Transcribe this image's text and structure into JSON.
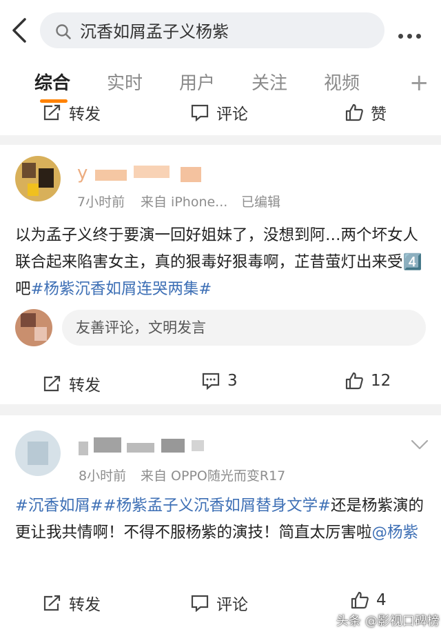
{
  "search": {
    "query": "沉香如屑孟子义杨紫"
  },
  "tabs": [
    {
      "label": "综合",
      "active": true
    },
    {
      "label": "实时",
      "active": false
    },
    {
      "label": "用户",
      "active": false
    },
    {
      "label": "关注",
      "active": false
    },
    {
      "label": "视频",
      "active": false
    }
  ],
  "add_tab": "+",
  "colors": {
    "accent": "#ff8200",
    "topic": "#3d6fb5"
  },
  "prev_post": {
    "actions": {
      "repost": "转发",
      "comment": "评论",
      "like": "赞"
    }
  },
  "post1": {
    "username": "y",
    "time": "7小时前",
    "source": "来自 iPhone...",
    "edited": "已编辑",
    "text_1": "以为孟子义终于要演一回好姐妹了，没想到阿…两个坏女人联合起来陷害女主，真的狠毒好狠毒啊，芷昔萤灯出来受",
    "emoji": "4️⃣",
    "text_2": "吧",
    "topic": "#杨紫沉香如屑连哭两集#",
    "comment_placeholder": "友善评论，文明发言",
    "actions": {
      "repost": "转发",
      "comment_count": "3",
      "like_count": "12"
    }
  },
  "post2": {
    "time": "8小时前",
    "source": "来自 OPPO随光而变R17",
    "topic_1": "#沉香如屑#",
    "topic_2": "#杨紫孟子义沉香如屑替身文学#",
    "text": "还是杨紫演的更让我共情啊！不得不服杨紫的演技！简直太厉害啦",
    "mention": "@杨紫",
    "actions": {
      "repost": "转发",
      "comment": "评论",
      "like_count": "4"
    }
  },
  "watermark": "头条 @影视口碑榜"
}
